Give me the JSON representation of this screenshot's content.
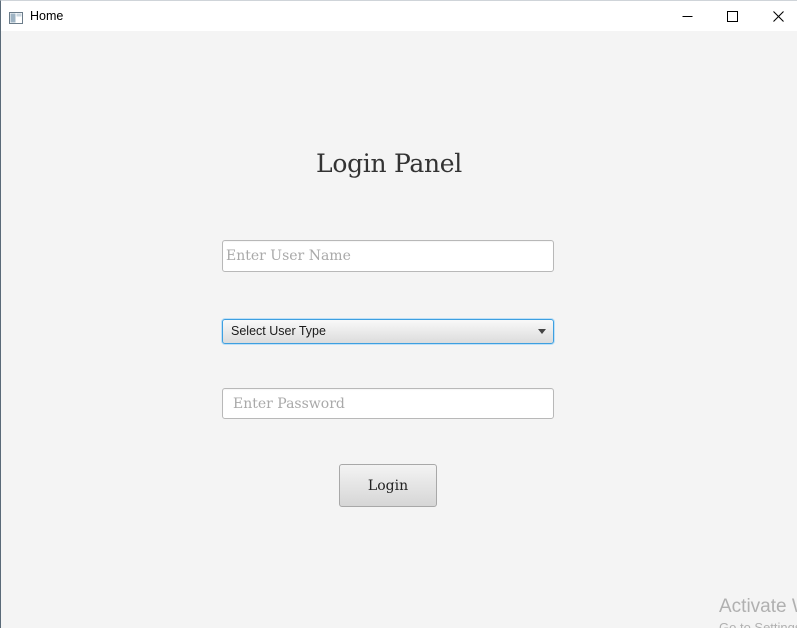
{
  "window": {
    "title": "Home",
    "controls": {
      "minimize": "minimize-icon",
      "maximize": "maximize-icon",
      "close": "close-icon"
    }
  },
  "login": {
    "heading": "Login Panel",
    "username": {
      "value": "",
      "placeholder": "Enter User Name"
    },
    "user_type": {
      "selected": "Select User Type"
    },
    "password": {
      "value": "",
      "placeholder": "Enter Password"
    },
    "submit_label": "Login"
  },
  "watermark": {
    "title": "Activate Windows",
    "subtitle": "Go to Settings to activate Windows."
  },
  "colors": {
    "background": "#f4f4f4",
    "focus_border": "#3d9fe0",
    "titlebar": "#ffffff"
  }
}
